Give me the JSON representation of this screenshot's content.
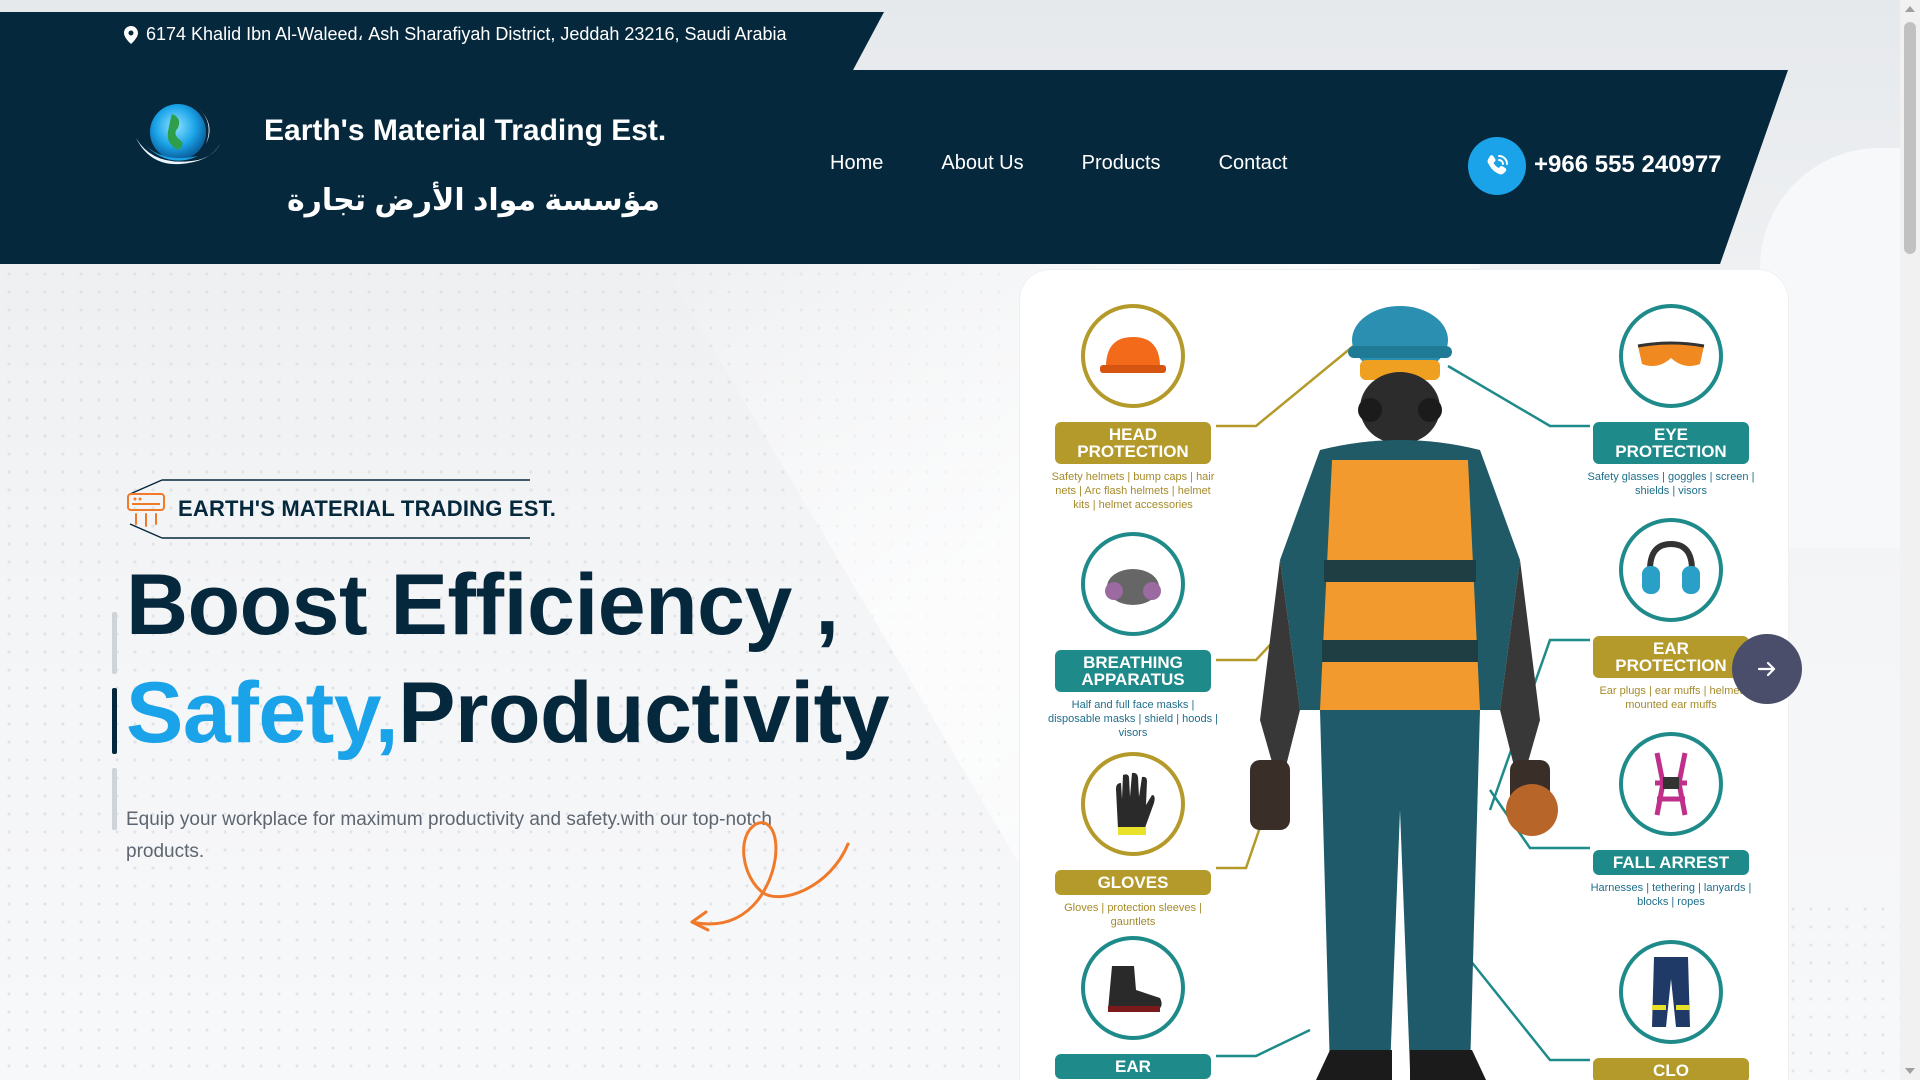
{
  "topbar": {
    "address": "6174 Khalid Ibn Al-Waleed، Ash Sharafiyah District, Jeddah 23216, Saudi Arabia"
  },
  "header": {
    "brand_en": "Earth's Material Trading Est.",
    "brand_ar": "مؤسسة مواد الأرض تجارة",
    "nav": [
      {
        "label": "Home"
      },
      {
        "label": "About Us"
      },
      {
        "label": "Products"
      },
      {
        "label": "Contact"
      }
    ],
    "phone": "+966 555 240977"
  },
  "hero": {
    "tag": "EARTH'S MATERIAL TRADING EST.",
    "headline_line1": "Boost Efficiency ,",
    "headline_accent": "Safety,",
    "headline_rest": "Productivity",
    "description": "Equip your workplace for maximum productivity and safety.with our top-notch products."
  },
  "ppe": {
    "head": {
      "label_1": "HEAD",
      "label_2": "PROTECTION",
      "desc": "Safety helmets | bump caps | hair nets | Arc flash helmets | helmet kits | helmet accessories"
    },
    "breathing": {
      "label_1": "BREATHING",
      "label_2": "APPARATUS",
      "desc": "Half and full face masks | disposable masks | shield | hoods | visors"
    },
    "gloves": {
      "label_1": "GLOVES",
      "desc": "Gloves | protection sleeves | gauntlets"
    },
    "footwear": {
      "label_1": "EAR"
    },
    "eye": {
      "label_1": "EYE",
      "label_2": "PROTECTION",
      "desc": "Safety glasses | goggles | screen | shields | visors"
    },
    "ear": {
      "label_1": "EAR",
      "label_2": "PROTECTION",
      "desc": "Ear plugs | ear muffs | helmet mounted ear muffs"
    },
    "fall": {
      "label_1": "FALL ARREST",
      "desc": "Harnesses | tethering | lanyards | blocks | ropes"
    },
    "clothing": {
      "label_1": "CLO"
    }
  },
  "colors": {
    "navy": "#06283d",
    "accent_blue": "#1aa3e8",
    "orange": "#f07a2a",
    "gold": "#b39a2a",
    "teal": "#1e8a8a"
  }
}
